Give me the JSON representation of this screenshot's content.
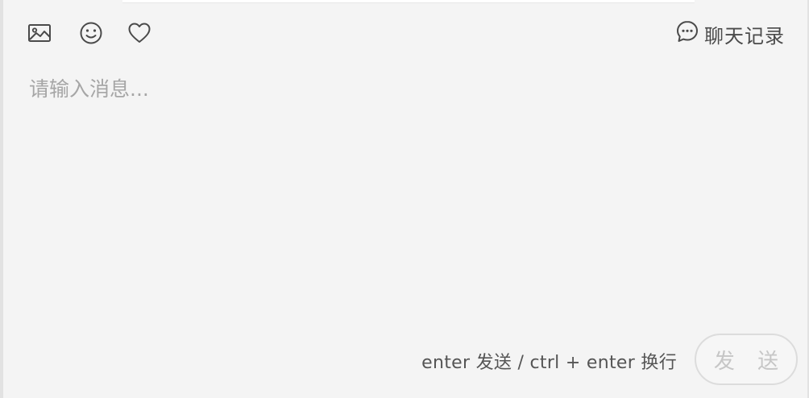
{
  "toolbar": {
    "icons": [
      "image-icon",
      "emoji-icon",
      "heart-icon"
    ],
    "history_label": "聊天记录",
    "history_icon": "chat-bubble-icon"
  },
  "composer": {
    "placeholder": "请输入消息...",
    "value": ""
  },
  "footer": {
    "hint": "enter 发送 / ctrl + enter 换行",
    "send_label": "发 送"
  },
  "colors": {
    "panel_background": "#f4f4f4",
    "icon_stroke": "#4a4a4a",
    "placeholder_text": "#a6a6a6",
    "send_button_border": "#dcdcdc",
    "send_button_text": "#c6c6c6"
  }
}
